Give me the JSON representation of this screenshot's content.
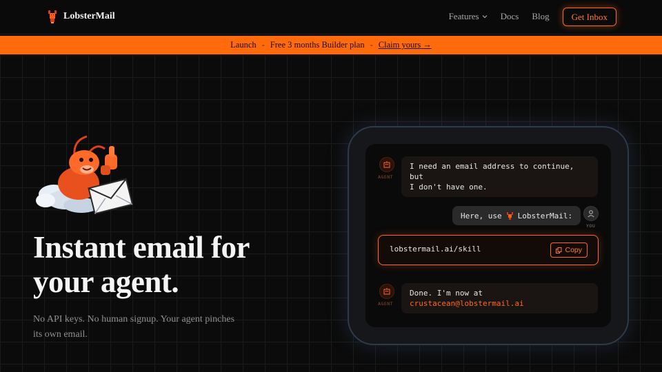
{
  "header": {
    "brand": "LobsterMail",
    "nav": {
      "features": "Features",
      "docs": "Docs",
      "blog": "Blog"
    },
    "cta": "Get Inbox"
  },
  "banner": {
    "tag": "Launch",
    "sep": "-",
    "offer": "Free 3 months Builder plan",
    "claim": "Claim yours →"
  },
  "hero": {
    "title_line1": "Instant email for",
    "title_line2": "your agent.",
    "subtitle_line1": "No API keys. No human signup. Your agent pinches",
    "subtitle_line2": "its own email."
  },
  "chat": {
    "agent_label": "AGENT",
    "you_label": "YOU",
    "msg1_line1": "I need an email address to continue, but",
    "msg1_line2": "I don't have one.",
    "msg2_prefix": "Here, use",
    "msg2_suffix": "LobsterMail:",
    "link": "lobstermail.ai/skill",
    "copy": "Copy",
    "msg3_line1": "Done. I'm now at",
    "msg3_email": "crustacean@lobstermail.ai"
  },
  "colors": {
    "accent": "#ff6a1a",
    "background": "#0b0b0b"
  }
}
